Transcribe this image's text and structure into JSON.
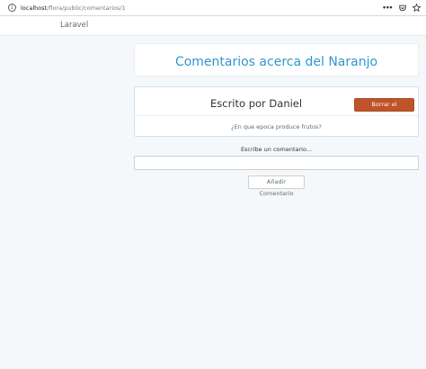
{
  "browser": {
    "url_host": "localhost",
    "url_path": "/flora/public/comentarios/1",
    "info_icon": "info-icon",
    "more_label": "•••",
    "icons": [
      "info-icon",
      "more-icon",
      "pocket-icon",
      "star-icon"
    ]
  },
  "navbar": {
    "brand": "Laravel"
  },
  "header": {
    "title": "Comentarios acerca del Naranjo"
  },
  "comment": {
    "author": "Escrito por Daniel",
    "delete_label": "Borrar el comentario",
    "text": "¿En que epoca produce frutos?"
  },
  "form": {
    "label": "Escribe un comentario...",
    "input_value": "",
    "submit_label": "Añadir Comentario"
  },
  "colors": {
    "title": "#3097d1",
    "danger": "#bf5329",
    "background": "#f5f8fa"
  }
}
